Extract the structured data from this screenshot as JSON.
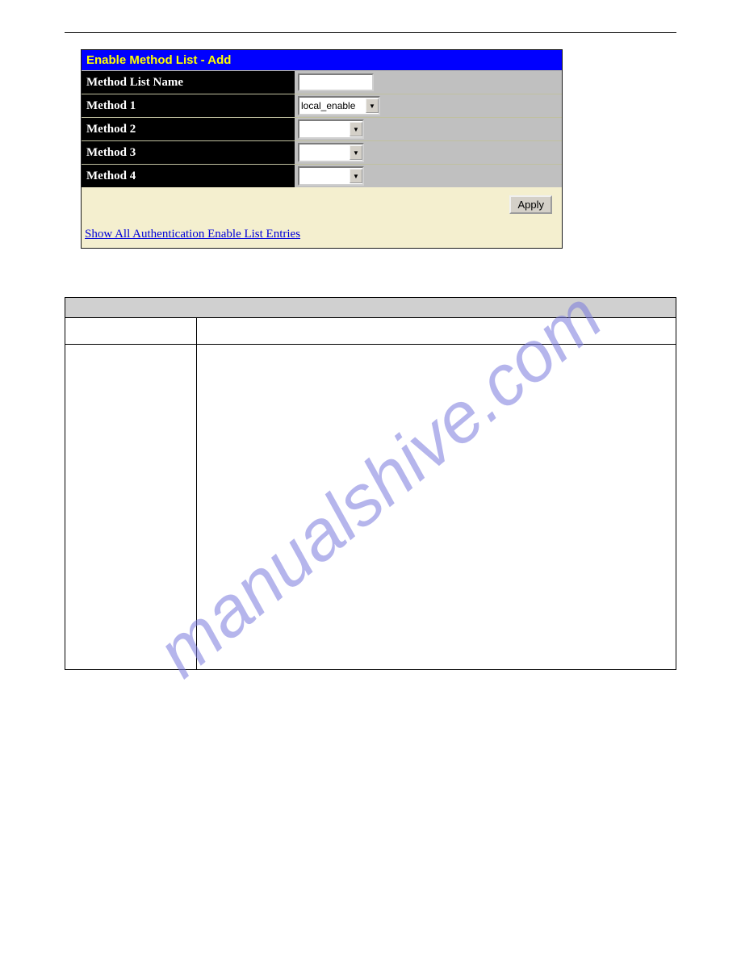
{
  "panel": {
    "title": "Enable Method List - Add",
    "rows": {
      "name_label": "Method List Name",
      "name_value": "",
      "m1_label": "Method 1",
      "m1_value": "local_enable",
      "m2_label": "Method 2",
      "m2_value": "",
      "m3_label": "Method 3",
      "m3_value": "",
      "m4_label": "Method 4",
      "m4_value": ""
    },
    "apply_label": "Apply",
    "link_text": "Show All Authentication Enable List Entries"
  },
  "watermark": "manualshive.com"
}
